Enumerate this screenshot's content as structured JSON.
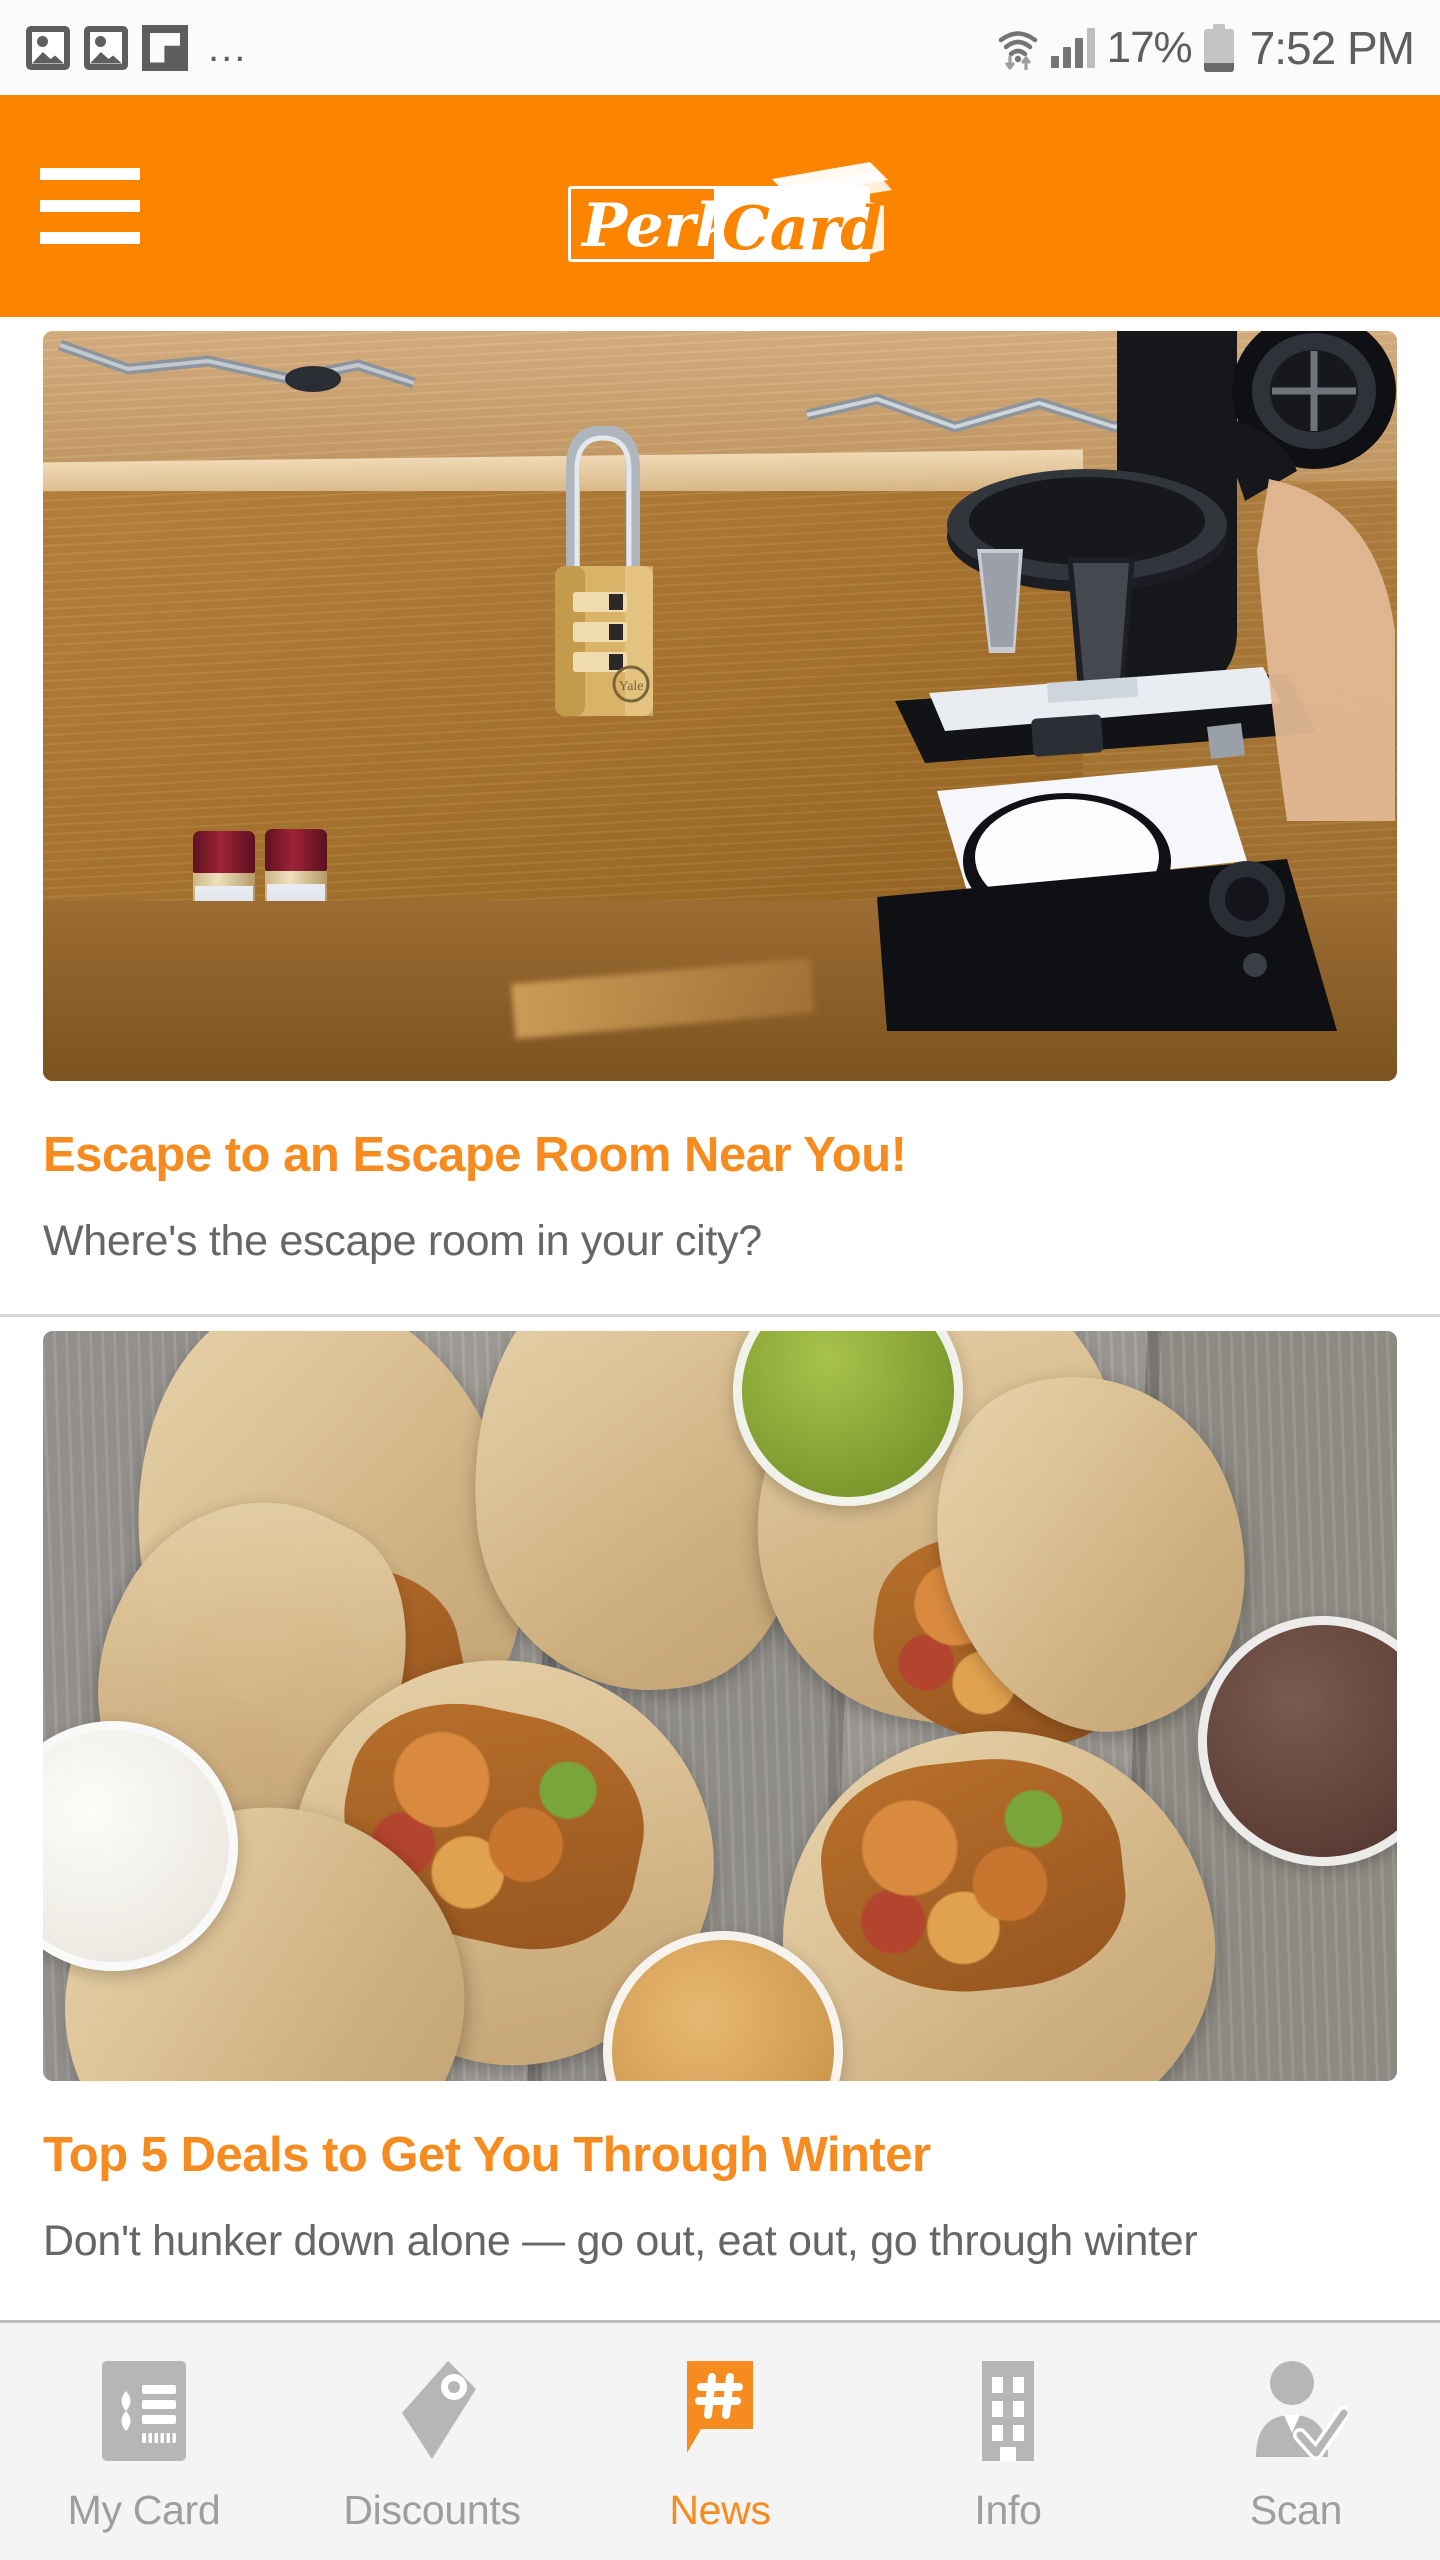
{
  "status_bar": {
    "notification_icons": [
      "photo-icon",
      "photo-icon",
      "flipboard-icon",
      "more-dots-icon"
    ],
    "more_dots": "...",
    "wifi_icon": "wifi-icon",
    "signal_icon": "signal-bars-icon",
    "battery_percent": "17%",
    "battery_icon": "battery-low-icon",
    "time": "7:52 PM"
  },
  "header": {
    "menu_icon": "hamburger-menu-icon",
    "brand_name": "Perks Card",
    "brand_word_1": "Perks",
    "brand_word_2": "Card",
    "background_color": "#fb8500"
  },
  "feed": {
    "articles": [
      {
        "image_alt": "padlock on wooden box with chain and microscope",
        "title": "Escape to an Escape Room Near You!",
        "subtitle": "Where's the escape room in your city?"
      },
      {
        "image_alt": "chicken wraps on wooden table with dipping sauces",
        "title": "Top 5 Deals to Get You Through Winter",
        "subtitle": "Don't hunker down alone — go out, eat out, go through winter"
      }
    ]
  },
  "bottom_nav": {
    "active_index": 2,
    "accent_color": "#f68b1f",
    "inactive_color": "#b6b6b6",
    "items": [
      {
        "label": "My Card",
        "icon": "id-card-icon"
      },
      {
        "label": "Discounts",
        "icon": "price-tag-icon"
      },
      {
        "label": "News",
        "icon": "news-hashtag-bubble-icon"
      },
      {
        "label": "Info",
        "icon": "building-icon"
      },
      {
        "label": "Scan",
        "icon": "person-check-icon"
      }
    ]
  }
}
